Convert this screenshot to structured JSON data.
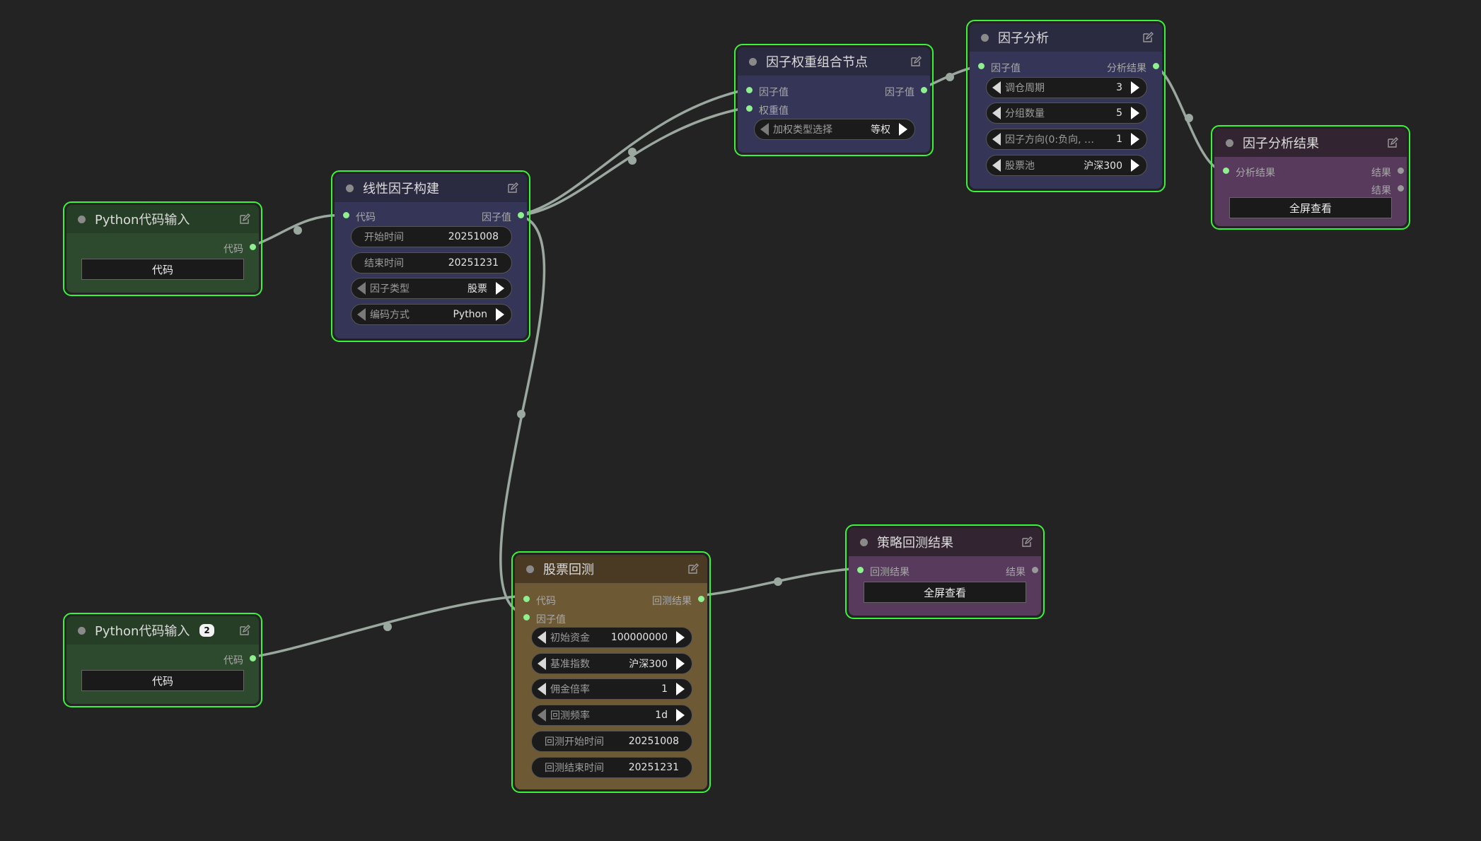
{
  "colors": {
    "background": "#232323",
    "node_border": "#3df23d",
    "link": "#9aa8a0",
    "green_node": "#2e4a2e",
    "green_title": "#263d26",
    "blue_node": "#353558",
    "blue_title": "#2a2a40",
    "purple_node": "#573a5c",
    "purple_title": "#322430",
    "brown_node": "#6d5a35",
    "brown_title": "#4a3a24"
  },
  "nodes": {
    "python_input_1": {
      "title": "Python代码输入",
      "out_label": "代码",
      "button": "代码"
    },
    "linear_factor": {
      "title": "线性因子构建",
      "in_label": "代码",
      "out_label": "因子值",
      "fields": [
        {
          "label": "开始时间",
          "value": "20251008"
        },
        {
          "label": "结束时间",
          "value": "20251231"
        },
        {
          "label": "因子类型",
          "value": "股票"
        },
        {
          "label": "编码方式",
          "value": "Python"
        }
      ]
    },
    "weight_combine": {
      "title": "因子权重组合节点",
      "in_label_1": "因子值",
      "in_label_2": "权重值",
      "out_label": "因子值",
      "combo": {
        "label": "加权类型选择",
        "value": "等权"
      }
    },
    "factor_analysis": {
      "title": "因子分析",
      "in_label": "因子值",
      "out_label": "分析结果",
      "fields": [
        {
          "label": "调仓周期",
          "value": "3"
        },
        {
          "label": "分组数量",
          "value": "5"
        },
        {
          "label": "因子方向(0:负向, …",
          "value": "1"
        },
        {
          "label": "股票池",
          "value": "沪深300"
        }
      ]
    },
    "factor_result": {
      "title": "因子分析结果",
      "in_label": "分析结果",
      "out_label_1": "结果",
      "out_label_2": "结果",
      "button": "全屏查看"
    },
    "python_input_2": {
      "title": "Python代码输入",
      "badge": "2",
      "out_label": "代码",
      "button": "代码"
    },
    "backtest": {
      "title": "股票回测",
      "in_label_1": "代码",
      "in_label_2": "因子值",
      "out_label": "回测结果",
      "fields": [
        {
          "label": "初始资金",
          "value": "100000000"
        },
        {
          "label": "基准指数",
          "value": "沪深300"
        },
        {
          "label": "佣金倍率",
          "value": "1"
        },
        {
          "label": "回测频率",
          "value": "1d"
        },
        {
          "label": "回测开始时间",
          "value": "20251008"
        },
        {
          "label": "回测结束时间",
          "value": "20251231"
        }
      ]
    },
    "backtest_result": {
      "title": "策略回测结果",
      "in_label": "回测结果",
      "out_label": "结果",
      "button": "全屏查看"
    }
  }
}
